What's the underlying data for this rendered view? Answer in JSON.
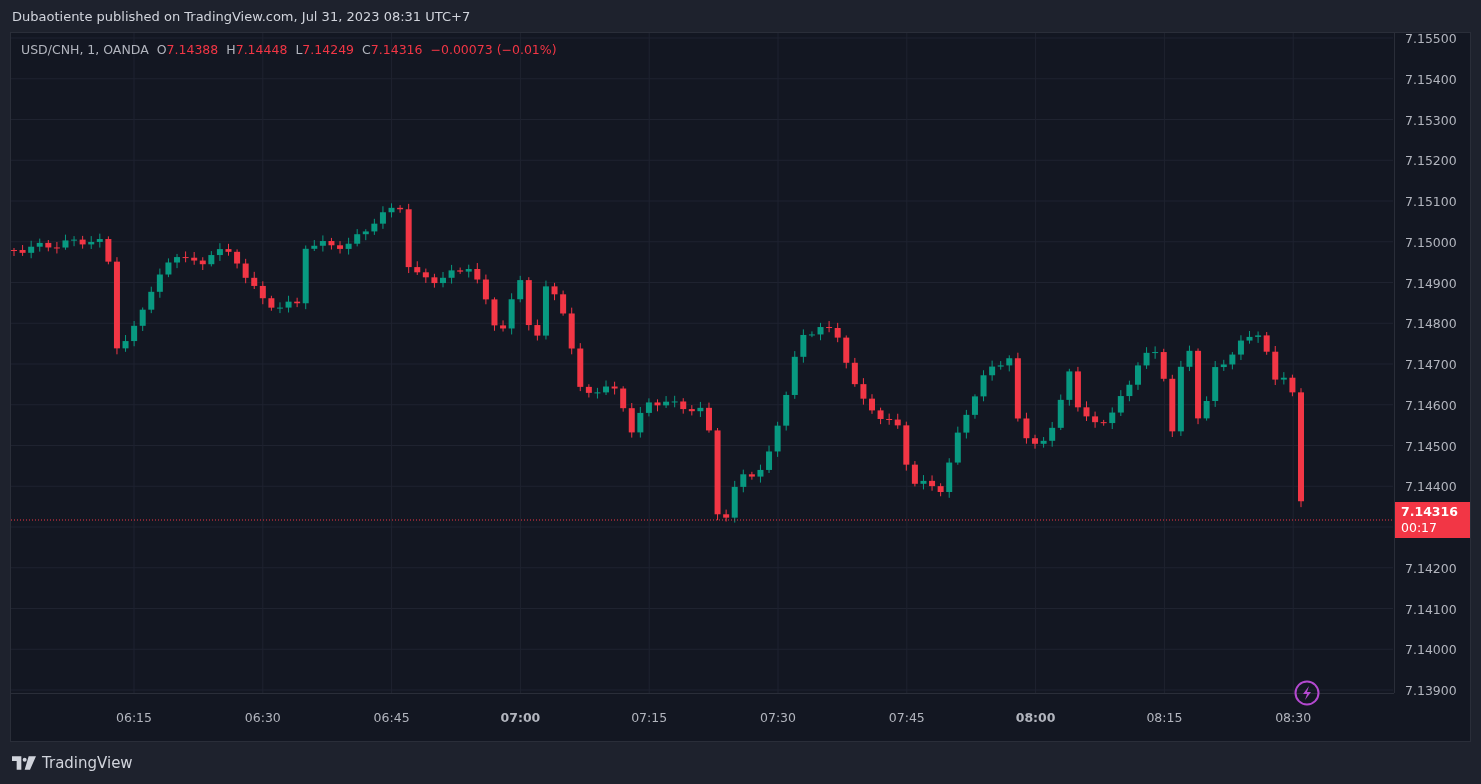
{
  "header": {
    "text": "Dubaotiente published on TradingView.com, Jul 31, 2023 08:31 UTC+7"
  },
  "legend": {
    "symbol": "USD/CNH, 1, OANDA",
    "values": [
      {
        "label": "O",
        "value": "7.14388"
      },
      {
        "label": "H",
        "value": "7.14448"
      },
      {
        "label": "L",
        "value": "7.14249"
      },
      {
        "label": "C",
        "value": "7.14316"
      }
    ],
    "change": "−0.00073 (−0.01%)"
  },
  "price_axis": {
    "ticks_above": [
      "7.15500",
      "7.15400",
      "7.15300",
      "7.15200",
      "7.15100",
      "7.15000",
      "7.14900",
      "7.14800",
      "7.14700",
      "7.14600",
      "7.14500",
      "7.14400"
    ],
    "ticks_below": [
      "7.14200",
      "7.14100",
      "7.14000",
      "7.13900"
    ]
  },
  "current_price": {
    "price": "7.14316",
    "countdown": "00:17"
  },
  "time_axis": {
    "labels": [
      {
        "text": "06:15",
        "major": false
      },
      {
        "text": "06:30",
        "major": false
      },
      {
        "text": "06:45",
        "major": false
      },
      {
        "text": "07:00",
        "major": true
      },
      {
        "text": "07:15",
        "major": false
      },
      {
        "text": "07:30",
        "major": false
      },
      {
        "text": "07:45",
        "major": false
      },
      {
        "text": "08:00",
        "major": true
      },
      {
        "text": "08:15",
        "major": false
      },
      {
        "text": "08:30",
        "major": false
      }
    ]
  },
  "footer": {
    "brand": "TradingView"
  }
}
